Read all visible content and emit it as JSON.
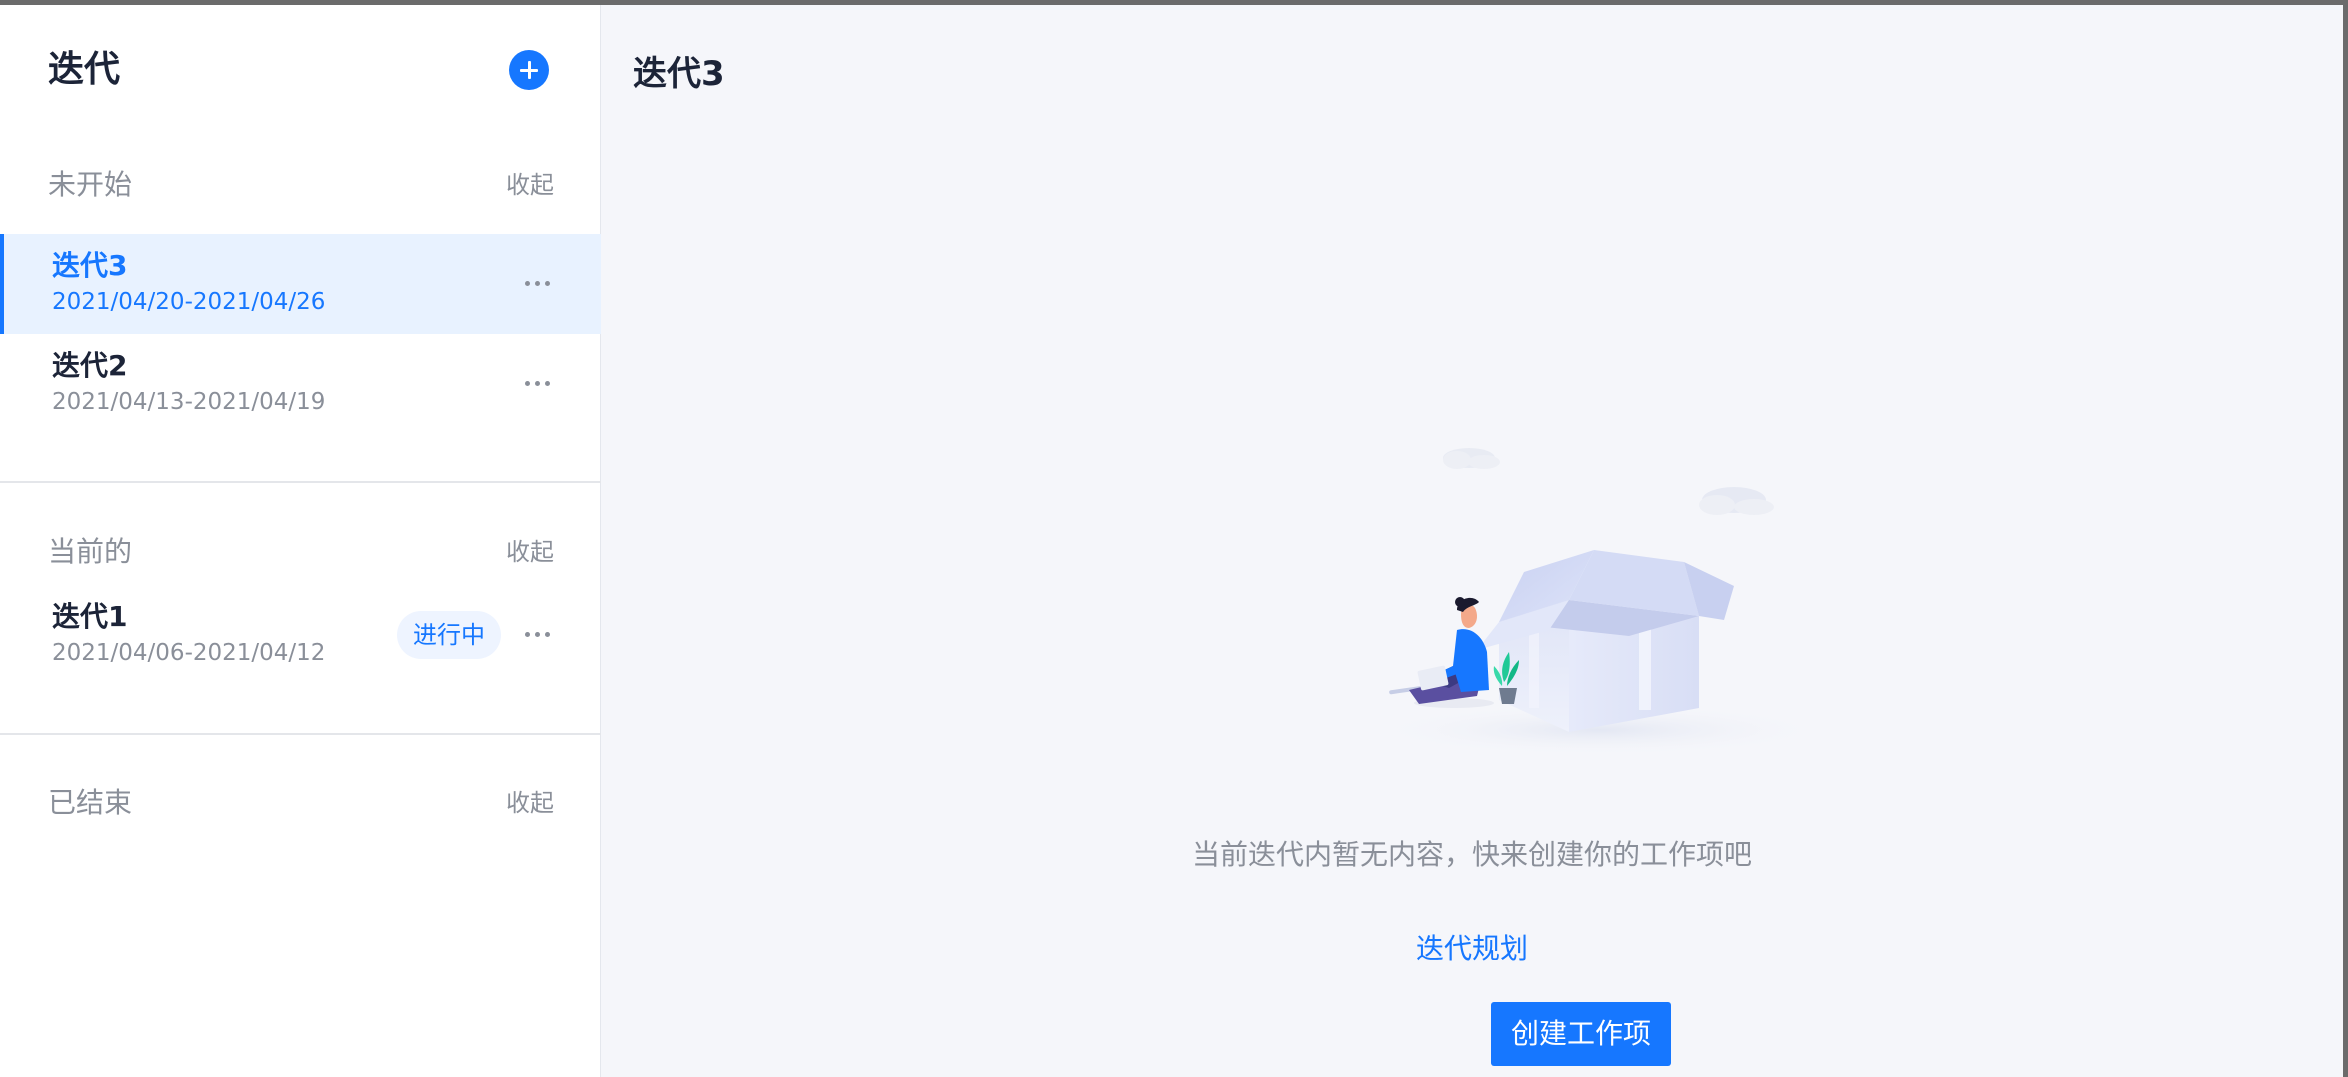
{
  "sidebar": {
    "title": "迭代",
    "add_icon": "plus-icon",
    "groups": [
      {
        "label": "未开始",
        "collapse_label": "收起",
        "items": [
          {
            "name": "迭代3",
            "dates": "2021/04/20-2021/04/26",
            "active": true
          },
          {
            "name": "迭代2",
            "dates": "2021/04/13-2021/04/19",
            "active": false
          }
        ]
      },
      {
        "label": "当前的",
        "collapse_label": "收起",
        "items": [
          {
            "name": "迭代1",
            "dates": "2021/04/06-2021/04/12",
            "status": "进行中",
            "active": false
          }
        ]
      },
      {
        "label": "已结束",
        "collapse_label": "收起",
        "items": []
      }
    ]
  },
  "main": {
    "title": "迭代3",
    "empty_text": "当前迭代内暂无内容，快来创建你的工作项吧",
    "plan_link": "迭代规划",
    "create_button": "创建工作项"
  },
  "colors": {
    "accent": "#1677ff",
    "active_bg": "#e8f2ff",
    "main_bg": "#f5f6fa",
    "muted_text": "#8a8f99",
    "title_text": "#1c2438"
  }
}
